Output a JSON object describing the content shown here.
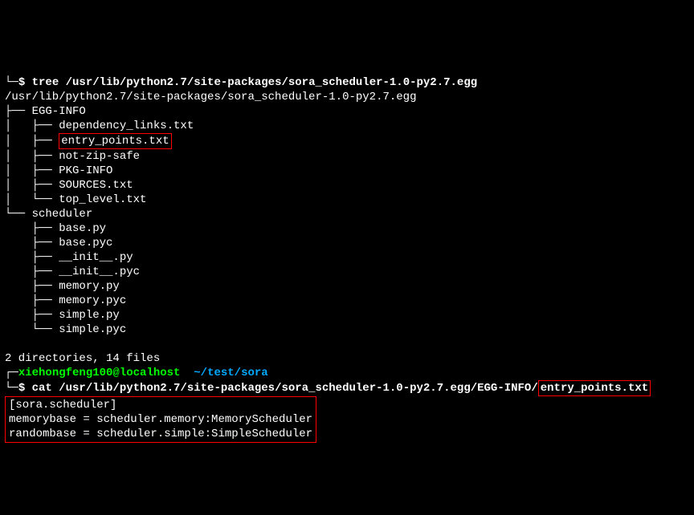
{
  "prompt1": {
    "arrow": "└─",
    "dollar": "$",
    "command": "tree /usr/lib/python2.7/site-packages/sora_scheduler-1.0-py2.7.egg"
  },
  "tree": {
    "root": "/usr/lib/python2.7/site-packages/sora_scheduler-1.0-py2.7.egg",
    "lines": [
      "├── EGG-INFO",
      "│   ├── dependency_links.txt",
      "│   ├── ",
      "│   ├── not-zip-safe",
      "│   ├── PKG-INFO",
      "│   ├── SOURCES.txt",
      "│   └── top_level.txt",
      "└── scheduler",
      "    ├── base.py",
      "    ├── base.pyc",
      "    ├── __init__.py",
      "    ├── __init__.pyc",
      "    ├── memory.py",
      "    ├── memory.pyc",
      "    ├── simple.py",
      "    └── simple.pyc"
    ],
    "highlighted_entry": "entry_points.txt",
    "summary": "2 directories, 14 files"
  },
  "prompt2": {
    "prefix": "┌─",
    "user_host": "xiehongfeng100@localhost",
    "cwd": "~/test/sora",
    "arrow": "└─",
    "dollar": "$",
    "command_prefix": "cat /usr/lib/python2.7/site-packages/sora_scheduler-1.0-py2.7.egg/EGG-INFO/",
    "command_highlight": "entry_points.txt"
  },
  "file_contents": {
    "line1": "[sora.scheduler]",
    "line2": "memorybase = scheduler.memory:MemoryScheduler",
    "line3": "randombase = scheduler.simple:SimpleScheduler"
  }
}
